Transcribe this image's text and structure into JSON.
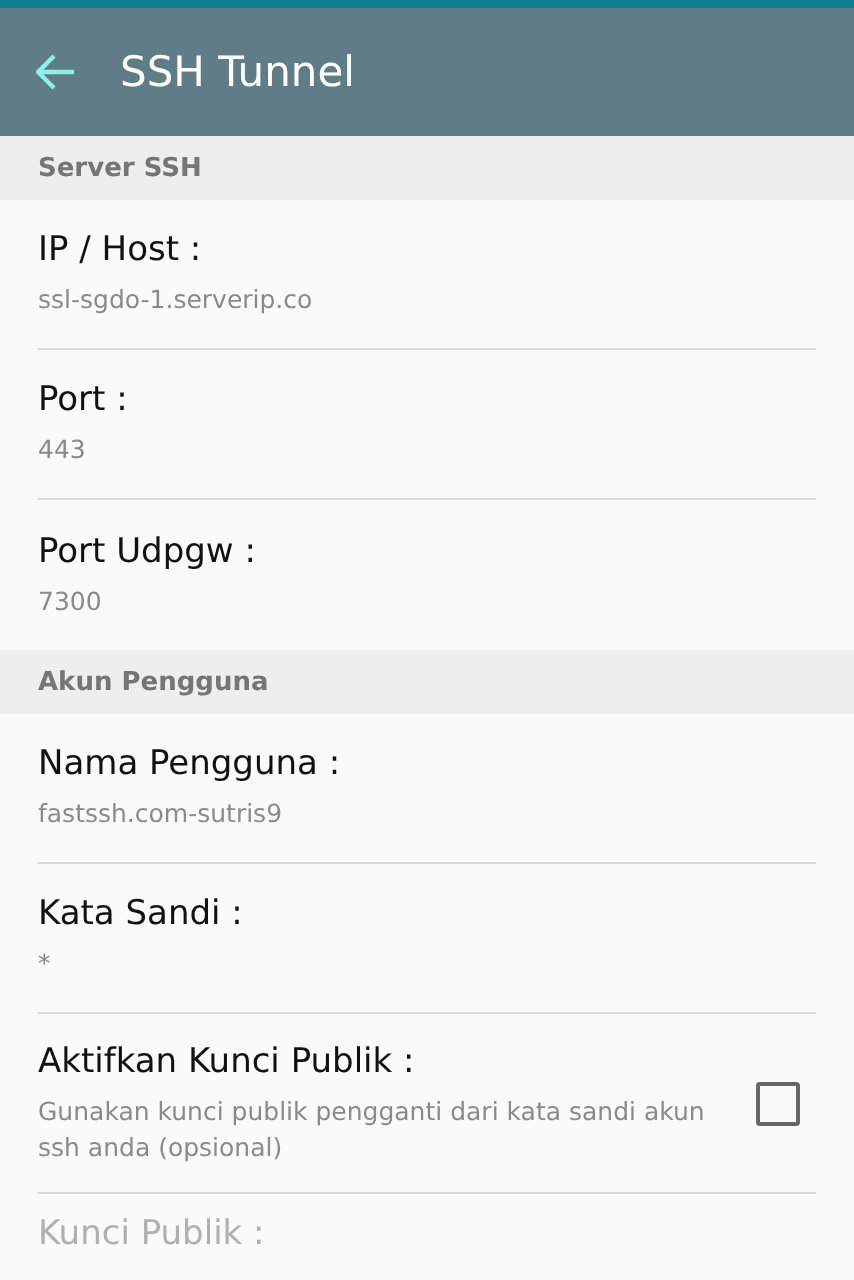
{
  "toolbar": {
    "title": "SSH Tunnel"
  },
  "sections": [
    {
      "header": "Server SSH",
      "items": [
        {
          "kind": "text",
          "title": "IP / Host :",
          "value": "ssl-sgdo-1.serverip.co",
          "disabled": false
        },
        {
          "kind": "text",
          "title": "Port :",
          "value": "443",
          "disabled": false
        },
        {
          "kind": "text",
          "title": "Port Udpgw :",
          "value": "7300",
          "disabled": false
        }
      ]
    },
    {
      "header": "Akun Pengguna",
      "items": [
        {
          "kind": "text",
          "title": "Nama Pengguna :",
          "value": "fastssh.com-sutris9",
          "disabled": false
        },
        {
          "kind": "text",
          "title": "Kata Sandi :",
          "value": "*",
          "disabled": false
        },
        {
          "kind": "checkbox",
          "title": "Aktifkan Kunci Publik :",
          "description": "Gunakan kunci publik pengganti dari kata sandi akun ssh anda (opsional)",
          "checked": false,
          "disabled": false
        },
        {
          "kind": "text",
          "title": "Kunci Publik :",
          "disabled": true
        }
      ]
    }
  ]
}
